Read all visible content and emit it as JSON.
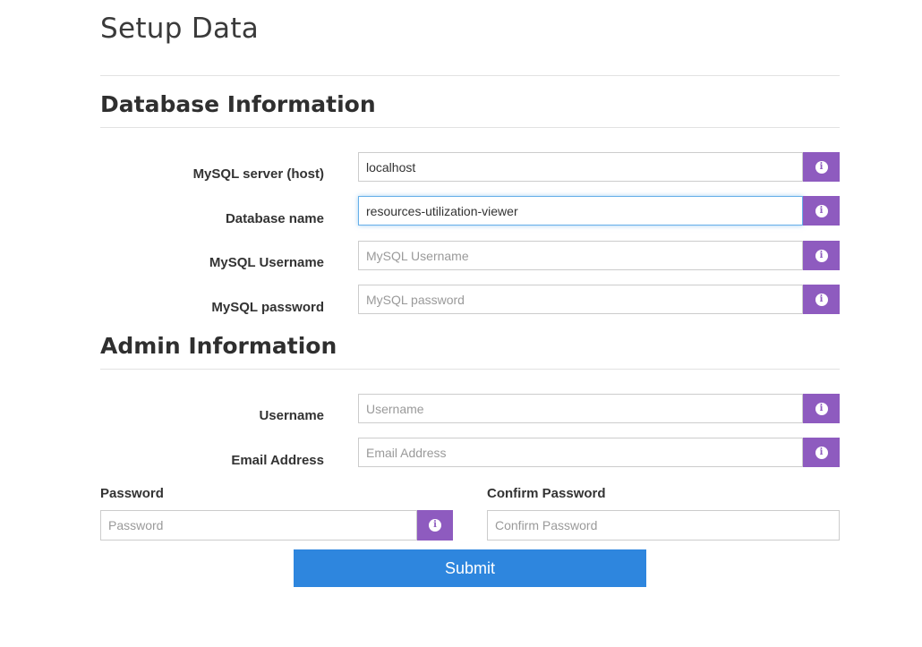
{
  "page": {
    "title": "Setup Data"
  },
  "database_section": {
    "heading": "Database Information",
    "fields": [
      {
        "label": "MySQL server (host)",
        "value": "localhost",
        "placeholder": "",
        "icon": "info-icon"
      },
      {
        "label": "Database name",
        "value": "resources-utilization-viewer",
        "placeholder": "",
        "icon": "info-icon"
      },
      {
        "label": "MySQL Username",
        "value": "",
        "placeholder": "MySQL Username",
        "icon": "info-icon"
      },
      {
        "label": "MySQL password",
        "value": "",
        "placeholder": "MySQL password",
        "icon": "info-icon"
      }
    ]
  },
  "admin_section": {
    "heading": "Admin Information",
    "fields": [
      {
        "label": "Username",
        "value": "",
        "placeholder": "Username",
        "icon": "info-icon"
      },
      {
        "label": "Email Address",
        "value": "",
        "placeholder": "Email Address",
        "icon": "info-icon"
      }
    ],
    "password": {
      "label": "Password",
      "value": "",
      "placeholder": "Password",
      "icon": "info-icon"
    },
    "confirm_password": {
      "label": "Confirm Password",
      "value": "",
      "placeholder": "Confirm Password"
    }
  },
  "submit": {
    "label": "Submit"
  },
  "colors": {
    "addon": "#8e5bbf",
    "submit": "#2e86de",
    "focus_border": "#66afe9"
  }
}
